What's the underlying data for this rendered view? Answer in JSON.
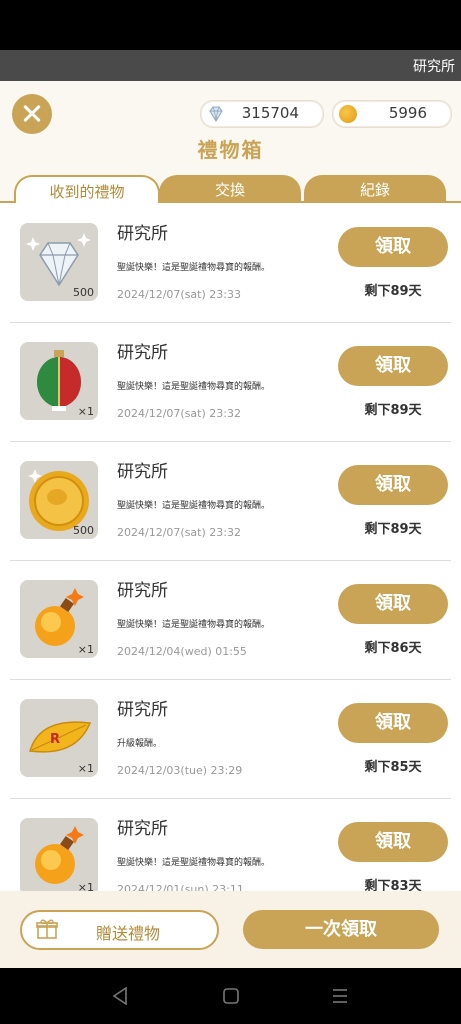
{
  "marquee": {
    "text": "研究所"
  },
  "currency": {
    "gems": "315704",
    "coins": "5996"
  },
  "header": {
    "title": "禮物箱"
  },
  "tabs": [
    {
      "label": "收到的禮物"
    },
    {
      "label": "交換"
    },
    {
      "label": "紀錄"
    }
  ],
  "gifts": [
    {
      "sender": "研究所",
      "message": "聖誕快樂！這是聖誕禮物尋寶的報酬。",
      "date": "2024/12/07(sat) 23:33",
      "quantity": "500",
      "item_icon": "diamond-icon",
      "claim_label": "領取",
      "remaining": "剩下89天"
    },
    {
      "sender": "研究所",
      "message": "聖誕快樂！這是聖誕禮物尋寶的報酬。",
      "date": "2024/12/07(sat) 23:32",
      "quantity": "×1",
      "item_icon": "christmas-ornament-icon",
      "claim_label": "領取",
      "remaining": "剩下89天"
    },
    {
      "sender": "研究所",
      "message": "聖誕快樂！這是聖誕禮物尋寶的報酬。",
      "date": "2024/12/07(sat) 23:32",
      "quantity": "500",
      "item_icon": "gold-coin-icon",
      "claim_label": "領取",
      "remaining": "剩下89天"
    },
    {
      "sender": "研究所",
      "message": "聖誕快樂！這是聖誕禮物尋寶的報酬。",
      "date": "2024/12/04(wed) 01:55",
      "quantity": "×1",
      "item_icon": "bomb-icon",
      "claim_label": "領取",
      "remaining": "剩下86天"
    },
    {
      "sender": "研究所",
      "message": "升級報酬。",
      "date": "2024/12/03(tue) 23:29",
      "quantity": "×1",
      "item_icon": "leaf-icon",
      "claim_label": "領取",
      "remaining": "剩下85天"
    },
    {
      "sender": "研究所",
      "message": "聖誕快樂！這是聖誕禮物尋寶的報酬。",
      "date": "2024/12/01(sun) 23:11",
      "quantity": "×1",
      "item_icon": "bomb-icon",
      "claim_label": "領取",
      "remaining": "剩下83天"
    }
  ],
  "footer": {
    "gift_label": "贈送禮物",
    "claim_all_label": "一次領取"
  },
  "colors": {
    "accent": "#c9a456",
    "panel_bg": "#fbf8f2"
  }
}
